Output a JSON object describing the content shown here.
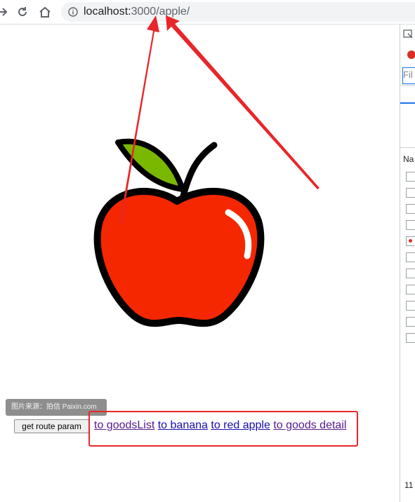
{
  "browser": {
    "url_host": "localhost:",
    "url_rest": "3000/apple/"
  },
  "page": {
    "watermark": "图片来源：拍信 Paixin.com",
    "button_label": "get route param",
    "links": [
      "to goodsList",
      "to banana",
      "to red apple",
      "to goods detail"
    ]
  },
  "devtools": {
    "filter_placeholder": "Fil",
    "column_name": "Na",
    "footer_text": "11"
  },
  "colors": {
    "apple_red": "#f42700",
    "leaf_green": "#7ab800",
    "annotation_red": "#e8262a"
  }
}
